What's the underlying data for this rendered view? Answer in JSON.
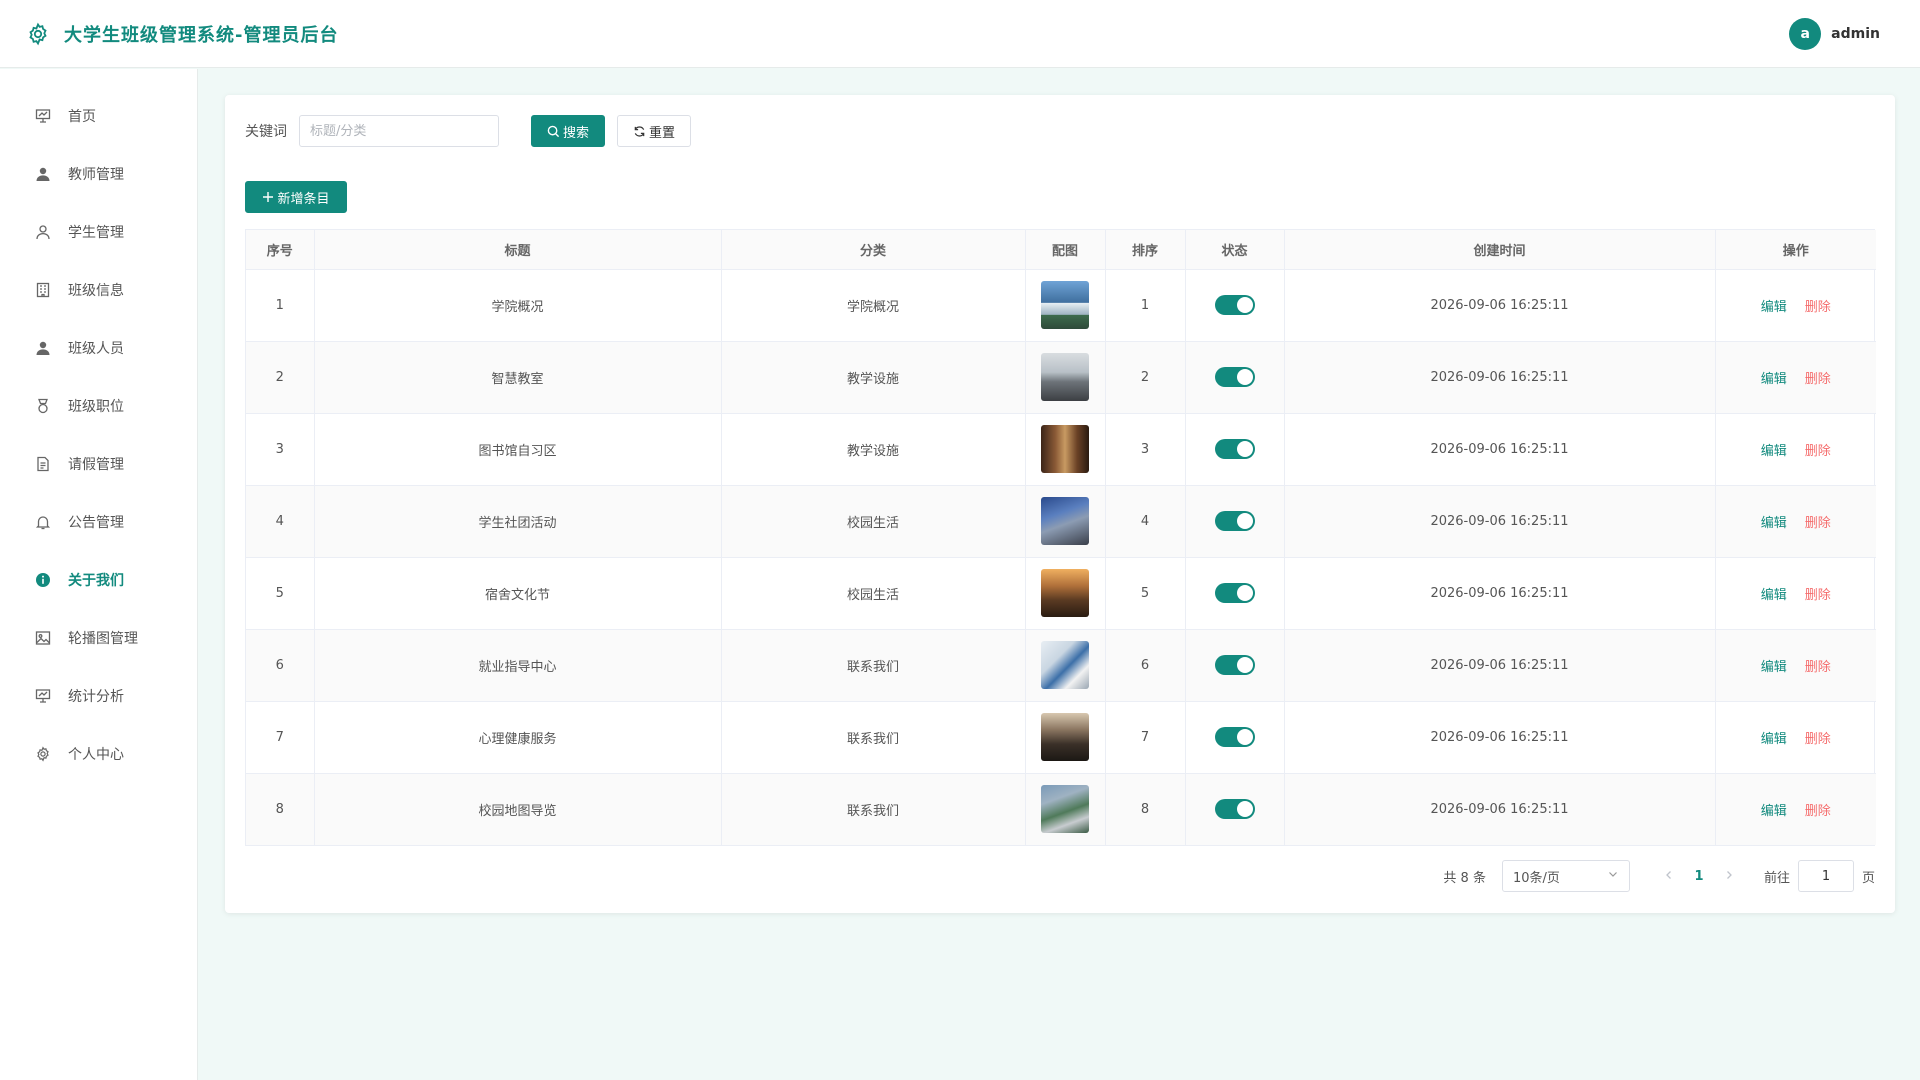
{
  "header": {
    "title": "大学生班级管理系统-管理员后台",
    "avatar_letter": "a",
    "username": "admin"
  },
  "sidebar": {
    "items": [
      {
        "label": "首页",
        "icon": "presentation-icon"
      },
      {
        "label": "教师管理",
        "icon": "user-solid-icon"
      },
      {
        "label": "学生管理",
        "icon": "user-outline-icon"
      },
      {
        "label": "班级信息",
        "icon": "building-icon"
      },
      {
        "label": "班级人员",
        "icon": "user-solid-icon"
      },
      {
        "label": "班级职位",
        "icon": "medal-icon"
      },
      {
        "label": "请假管理",
        "icon": "document-icon"
      },
      {
        "label": "公告管理",
        "icon": "bell-icon"
      },
      {
        "label": "关于我们",
        "icon": "info-icon",
        "active": true
      },
      {
        "label": "轮播图管理",
        "icon": "picture-icon"
      },
      {
        "label": "统计分析",
        "icon": "presentation-icon"
      },
      {
        "label": "个人中心",
        "icon": "gear-icon"
      }
    ]
  },
  "search": {
    "label": "关键词",
    "placeholder": "标题/分类",
    "search_label": "搜索",
    "reset_label": "重置"
  },
  "add_label": "新增条目",
  "table": {
    "headers": [
      "序号",
      "标题",
      "分类",
      "配图",
      "排序",
      "状态",
      "创建时间",
      "操作"
    ],
    "edit_label": "编辑",
    "delete_label": "删除",
    "rows": [
      {
        "index": "1",
        "title": "学院概况",
        "category": "学院概况",
        "sort": "1",
        "status": true,
        "created": "2026-09-06 16:25:11"
      },
      {
        "index": "2",
        "title": "智慧教室",
        "category": "教学设施",
        "sort": "2",
        "status": true,
        "created": "2026-09-06 16:25:11"
      },
      {
        "index": "3",
        "title": "图书馆自习区",
        "category": "教学设施",
        "sort": "3",
        "status": true,
        "created": "2026-09-06 16:25:11"
      },
      {
        "index": "4",
        "title": "学生社团活动",
        "category": "校园生活",
        "sort": "4",
        "status": true,
        "created": "2026-09-06 16:25:11"
      },
      {
        "index": "5",
        "title": "宿舍文化节",
        "category": "校园生活",
        "sort": "5",
        "status": true,
        "created": "2026-09-06 16:25:11"
      },
      {
        "index": "6",
        "title": "就业指导中心",
        "category": "联系我们",
        "sort": "6",
        "status": true,
        "created": "2026-09-06 16:25:11"
      },
      {
        "index": "7",
        "title": "心理健康服务",
        "category": "联系我们",
        "sort": "7",
        "status": true,
        "created": "2026-09-06 16:25:11"
      },
      {
        "index": "8",
        "title": "校园地图导览",
        "category": "联系我们",
        "sort": "8",
        "status": true,
        "created": "2026-09-06 16:25:11"
      }
    ]
  },
  "pagination": {
    "total_text": "共 8 条",
    "page_size": "10条/页",
    "current_page": "1",
    "goto_label": "前往",
    "goto_value": "1",
    "unit_label": "页"
  },
  "colors": {
    "accent": "#128a7e",
    "danger": "#f56c6c",
    "background": "#f0f9f7"
  }
}
